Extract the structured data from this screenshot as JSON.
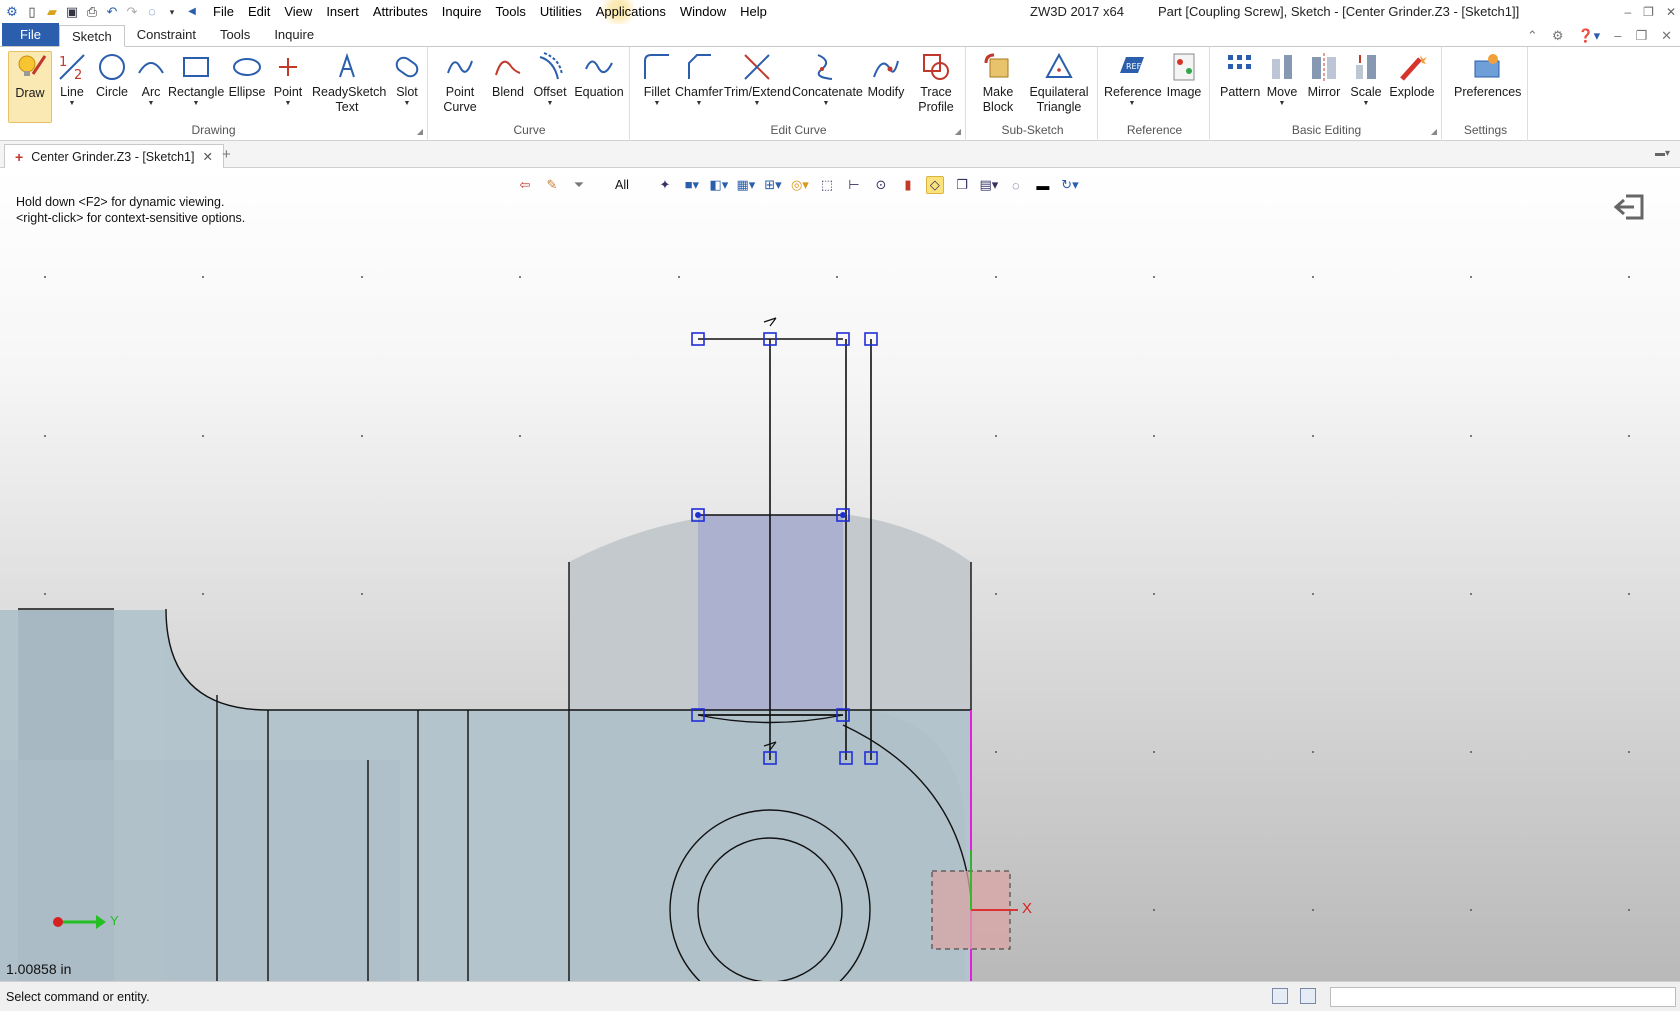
{
  "window": {
    "app_name": "ZW3D 2017  x64",
    "doc_title": "Part [Coupling Screw],  Sketch - [Center Grinder.Z3 - [Sketch1]]"
  },
  "menu": [
    "File",
    "Edit",
    "View",
    "Insert",
    "Attributes",
    "Inquire",
    "Tools",
    "Utilities",
    "Applications",
    "Window",
    "Help"
  ],
  "ribbon_tabs": [
    "File",
    "Sketch",
    "Constraint",
    "Tools",
    "Inquire"
  ],
  "active_ribbon_tab": "Sketch",
  "ribbon": {
    "drawing": {
      "label": "Drawing",
      "tools": [
        "Draw",
        "Line",
        "Circle",
        "Arc",
        "Rectangle",
        "Ellipse",
        "Point",
        "ReadySketch Text",
        "Slot"
      ]
    },
    "curve": {
      "label": "Curve",
      "tools": [
        "Point Curve",
        "Blend",
        "Offset",
        "Equation"
      ]
    },
    "edit_curve": {
      "label": "Edit Curve",
      "tools": [
        "Fillet",
        "Chamfer",
        "Trim/Extend",
        "Concatenate",
        "Modify",
        "Trace Profile"
      ]
    },
    "sub_sketch": {
      "label": "Sub-Sketch",
      "tools": [
        "Make Block",
        "Equilateral Triangle"
      ]
    },
    "reference": {
      "label": "Reference",
      "tools": [
        "Reference",
        "Image"
      ]
    },
    "basic_editing": {
      "label": "Basic Editing",
      "tools": [
        "Pattern",
        "Move",
        "Mirror",
        "Scale",
        "Explode"
      ]
    },
    "settings": {
      "label": "Settings",
      "tools": [
        "Preferences"
      ]
    }
  },
  "document_tab": "Center Grinder.Z3 - [Sketch1]",
  "view_toolbar": {
    "filter": "All"
  },
  "hints": [
    "Hold down <F2> for dynamic viewing.",
    "<right-click> for context-sensitive options."
  ],
  "axis_labels": {
    "x": "X",
    "y": "Y"
  },
  "measurement": "1.00858 in",
  "status": "Select command or entity.",
  "colors": {
    "sketch_handles": "#1f2fd6",
    "file_tab": "#2b5fad",
    "highlight": "#fbe9b3",
    "axis_magenta": "#e020e0",
    "axis_x": "#e02020",
    "axis_y": "#22c022"
  }
}
